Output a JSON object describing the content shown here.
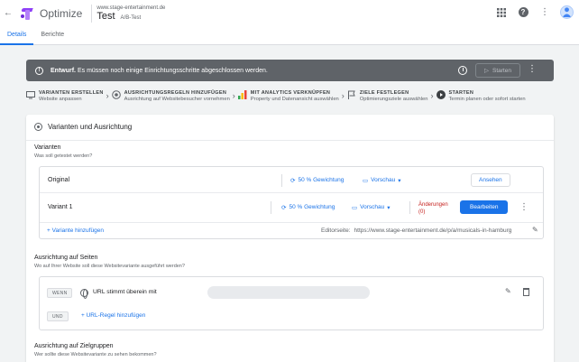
{
  "header": {
    "app_name": "Optimize",
    "domain": "www.stage-entertainment.de",
    "experiment_name": "Test",
    "experiment_type": "A/B-Test",
    "back_glyph": "←"
  },
  "tabs": [
    {
      "label": "Details",
      "active": true
    },
    {
      "label": "Berichte",
      "active": false
    }
  ],
  "banner": {
    "label": "Entwurf.",
    "message": "Es müssen noch einige Einrichtungsschritte abgeschlossen werden.",
    "start_label": "Starten"
  },
  "steps": [
    {
      "title": "VARIANTEN ERSTELLEN",
      "subtitle": "Website anpassen",
      "icon": "monitor-icon"
    },
    {
      "title": "AUSRICHTUNGSREGELN HINZUFÜGEN",
      "subtitle": "Ausrichtung auf Websitebesucher vornehmen",
      "icon": "target-icon"
    },
    {
      "title": "MIT ANALYTICS VERKNÜPFEN",
      "subtitle": "Property und Datenansicht auswählen",
      "icon": "analytics-icon"
    },
    {
      "title": "ZIELE FESTLEGEN",
      "subtitle": "Optimierungsziele auswählen",
      "icon": "flag-icon"
    },
    {
      "title": "STARTEN",
      "subtitle": "Termin planen oder sofort starten",
      "icon": "play-icon"
    }
  ],
  "card": {
    "title": "Varianten und Ausrichtung",
    "variants_heading": "Varianten",
    "variants_sub": "Was soll getestet werden?",
    "variants": [
      {
        "name": "Original",
        "weight": "50 % Gewichtung",
        "preview": "Vorschau",
        "action": "Ansehen"
      },
      {
        "name": "Variant 1",
        "weight": "50 % Gewichtung",
        "preview": "Vorschau",
        "changes": "Änderungen",
        "changes_count": "(0)",
        "action": "Bearbeiten"
      }
    ],
    "add_variant": "+ Variante hinzufügen",
    "editor_page_label": "Editorseite:",
    "editor_page_url": "https://www.stage-entertainment.de/p/a/musicals-in-hamburg",
    "pages_heading": "Ausrichtung auf Seiten",
    "pages_sub": "Wo auf Ihrer Website soll diese Websitevariante ausgeführt werden?",
    "rule_when": "WENN",
    "rule_condition": "URL stimmt überein mit",
    "rule_and": "UND",
    "add_rule": "+ URL-Regel hinzufügen",
    "audience_heading": "Ausrichtung auf Zielgruppen",
    "audience_sub": "Wer sollte diese Websitevariante zu sehen bekommen?"
  },
  "colors": {
    "accent": "#1a73e8",
    "banner_bg": "#5f6368",
    "changes_red": "#c5221f",
    "brand_purple": "#8e3ff7"
  }
}
